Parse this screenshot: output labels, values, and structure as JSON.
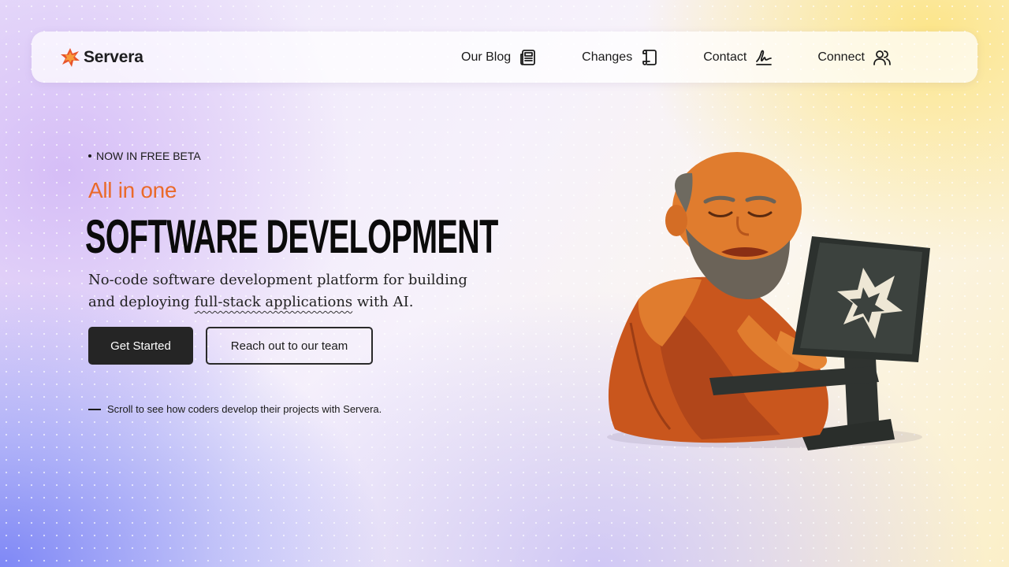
{
  "nav": {
    "brand_name": "Servera",
    "links": [
      {
        "label": "Our Blog",
        "icon": "newspaper-icon"
      },
      {
        "label": "Changes",
        "icon": "scroll-icon"
      },
      {
        "label": "Contact",
        "icon": "signature-icon"
      },
      {
        "label": "Connect",
        "icon": "users-icon"
      }
    ]
  },
  "hero": {
    "badge": "NOW IN FREE BETA",
    "eyebrow": "All in one",
    "headline": "SOFTWARE DEVELOPMENT",
    "subtitle_before": "No-code software development platform for building and deploying ",
    "subtitle_highlight": "full-stack applications",
    "subtitle_after": " with AI.",
    "primary_button": "Get Started",
    "secondary_button": "Reach out to our team",
    "scroll_hint": "Scroll to see how coders develop their projects with Servera."
  },
  "colors": {
    "accent": "#ea6a2a",
    "button_dark": "#252525",
    "text": "#111111"
  }
}
